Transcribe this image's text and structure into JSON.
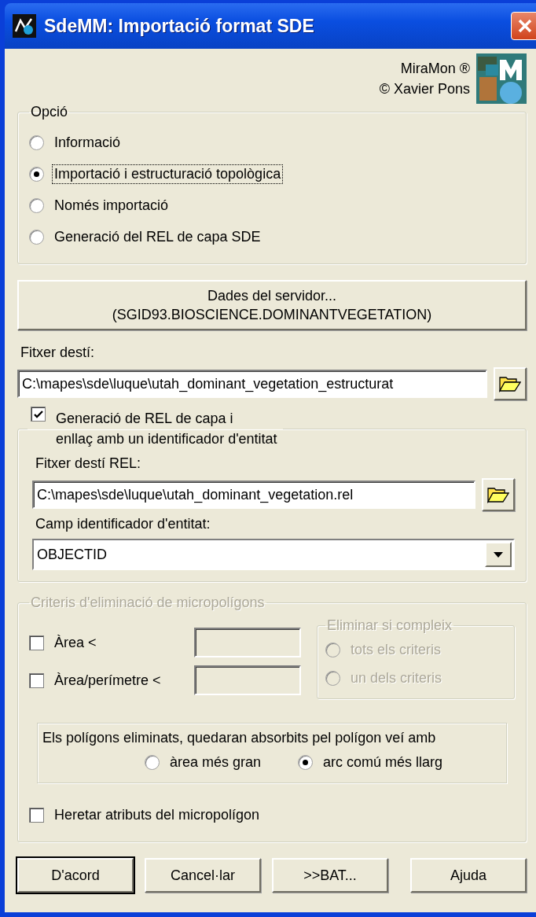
{
  "window": {
    "title": "SdeMM: Importació format SDE"
  },
  "brand": {
    "lines": [
      "MiraMon ®",
      "© Xavier Pons"
    ]
  },
  "option_group": {
    "legend": "Opció",
    "options": [
      {
        "label": "Informació",
        "selected": false
      },
      {
        "label": "Importació i estructuració topològica",
        "selected": true
      },
      {
        "label": "Només importació",
        "selected": false
      },
      {
        "label": "Generació del REL de capa SDE",
        "selected": false
      }
    ]
  },
  "server_button": {
    "lines": [
      "Dades del servidor...",
      "(SGID93.BIOSCIENCE.DOMINANTVEGETATION)"
    ]
  },
  "output_file": {
    "label": "Fitxer destí:",
    "value": "C:\\mapes\\sde\\luque\\utah_dominant_vegetation_estructurat"
  },
  "rel_group": {
    "checked": true,
    "lines": [
      "Generació de REL de capa i",
      "enllaç amb un identificador d'entitat"
    ],
    "file_label": "Fitxer destí REL:",
    "file_value": "C:\\mapes\\sde\\luque\\utah_dominant_vegetation.rel",
    "field_label": "Camp identificador d'entitat:",
    "field_value": "OBJECTID"
  },
  "criteria_group": {
    "legend": "Criteris d'eliminació de micropolígons",
    "disabled": true,
    "criteria": [
      {
        "label": "Àrea <",
        "checked": false
      },
      {
        "label": "Àrea/perímetre <",
        "checked": false
      }
    ],
    "eliminate": {
      "legend": "Eliminar si compleix",
      "disabled": true,
      "options": [
        {
          "label": "tots els criteris",
          "selected": false
        },
        {
          "label": "un dels criteris",
          "selected": false
        }
      ]
    },
    "absorb": {
      "text": "Els polígons eliminats, quedaran absorbits pel polígon veí amb",
      "options": [
        {
          "label": "àrea més gran",
          "selected": false
        },
        {
          "label": "arc comú més llarg",
          "selected": true
        }
      ]
    },
    "inherit": {
      "label": "Heretar atributs del micropolígon",
      "checked": false
    }
  },
  "buttons": [
    {
      "label": "D'acord",
      "default": true
    },
    {
      "label": "Cancel·lar",
      "default": false
    },
    {
      "label": ">>BAT...",
      "default": false
    },
    {
      "label": "Ajuda",
      "default": false
    }
  ]
}
